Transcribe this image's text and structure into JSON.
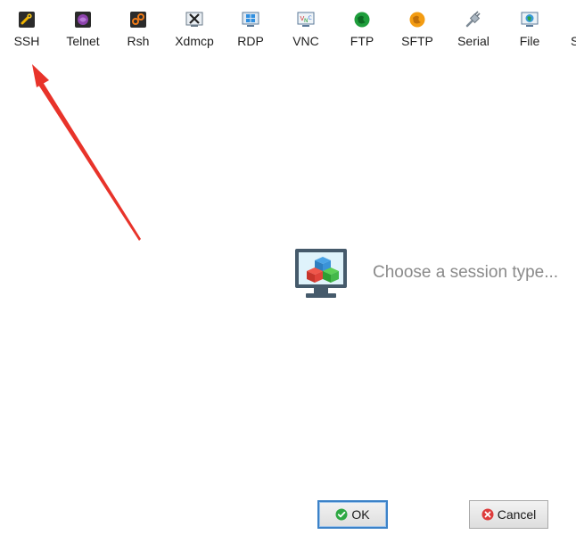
{
  "toolbar": {
    "items": [
      {
        "label": "SSH",
        "icon": "ssh-icon"
      },
      {
        "label": "Telnet",
        "icon": "telnet-icon"
      },
      {
        "label": "Rsh",
        "icon": "rsh-icon"
      },
      {
        "label": "Xdmcp",
        "icon": "xdmcp-icon"
      },
      {
        "label": "RDP",
        "icon": "rdp-icon"
      },
      {
        "label": "VNC",
        "icon": "vnc-icon"
      },
      {
        "label": "FTP",
        "icon": "ftp-icon"
      },
      {
        "label": "SFTP",
        "icon": "sftp-icon"
      },
      {
        "label": "Serial",
        "icon": "serial-icon"
      },
      {
        "label": "File",
        "icon": "file-icon"
      },
      {
        "label": "S",
        "icon": "partial-icon"
      }
    ]
  },
  "main": {
    "placeholder_text": "Choose a session type...",
    "illustration_icon": "session-monitor-icon"
  },
  "annotation": {
    "arrow_color": "#e8332a"
  },
  "buttons": {
    "ok_label": "OK",
    "cancel_label": "Cancel",
    "ok_icon": "check-circle-icon",
    "cancel_icon": "x-circle-icon"
  }
}
